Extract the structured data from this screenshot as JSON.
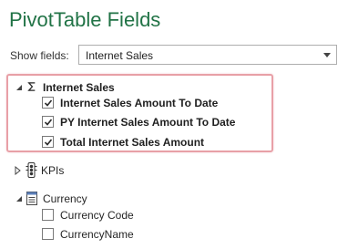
{
  "panel": {
    "title": "PivotTable Fields"
  },
  "show_fields": {
    "label": "Show fields:",
    "selected": "Internet Sales"
  },
  "tree": {
    "internet_sales": {
      "label": "Internet Sales",
      "expanded": true,
      "icon": "sigma-icon",
      "fields": [
        {
          "label": "Internet Sales Amount To Date",
          "checked": true
        },
        {
          "label": "PY Internet Sales Amount To Date",
          "checked": true
        },
        {
          "label": "Total Internet Sales Amount",
          "checked": true
        }
      ]
    },
    "kpis": {
      "label": "KPIs",
      "expanded": false,
      "icon": "kpi-traffic-light-icon"
    },
    "currency": {
      "label": "Currency",
      "expanded": true,
      "icon": "table-icon",
      "fields": [
        {
          "label": "Currency Code",
          "checked": false
        },
        {
          "label": "CurrencyName",
          "checked": false
        }
      ]
    }
  },
  "colors": {
    "title": "#217346",
    "highlight_border": "#e8a0a7"
  }
}
